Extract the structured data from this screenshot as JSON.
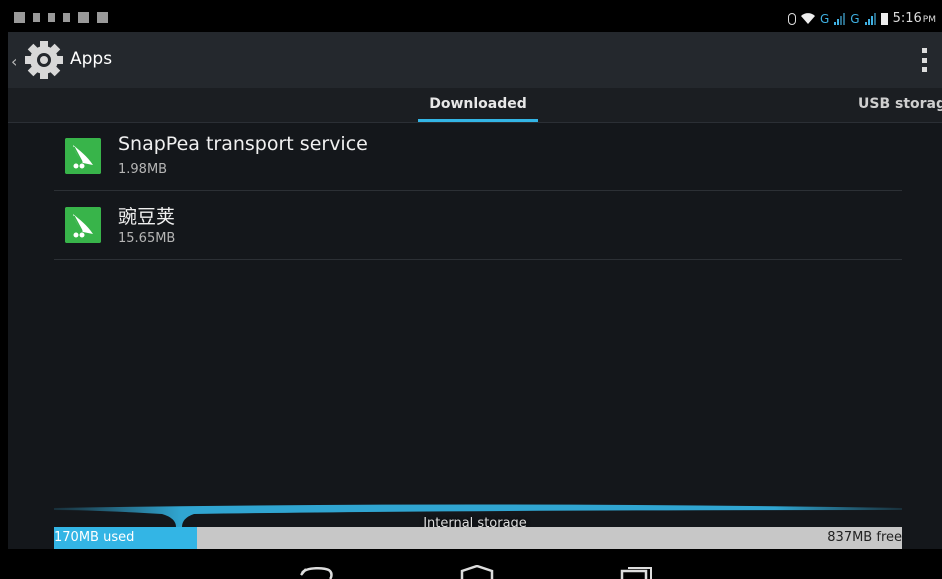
{
  "status_bar": {
    "time": "5:16",
    "ampm": "PM",
    "network_1": "G",
    "network_2": "G",
    "left_icons": [
      "notification-icon",
      "wifi-small-icon",
      "usb-icon",
      "lock-icon",
      "notification-icon",
      "notification-icon"
    ],
    "right_icons": [
      "bluetooth-icon",
      "wifi-icon",
      "signal-icon",
      "signal-icon",
      "battery-icon"
    ]
  },
  "action_bar": {
    "title": "Apps",
    "icon": "settings-gear-icon",
    "overflow_icon": "overflow-menu-icon"
  },
  "tabs": [
    {
      "label": "Downloaded",
      "selected": true
    },
    {
      "label": "USB storage",
      "selected": false
    }
  ],
  "apps": [
    {
      "name": "SnapPea transport service",
      "size": "1.98MB",
      "icon": "snappea-icon"
    },
    {
      "name": "豌豆荚",
      "size": "15.65MB",
      "icon": "snappea-icon"
    }
  ],
  "storage": {
    "label": "Internal storage",
    "used": "170MB used",
    "free": "837MB free",
    "used_fraction": 0.169
  },
  "nav": {
    "icons": [
      "back-nav-icon",
      "home-nav-icon",
      "recents-nav-icon"
    ]
  },
  "colors": {
    "accent": "#33b5e5",
    "app_icon_bg": "#38b44a",
    "background": "#14171b"
  }
}
